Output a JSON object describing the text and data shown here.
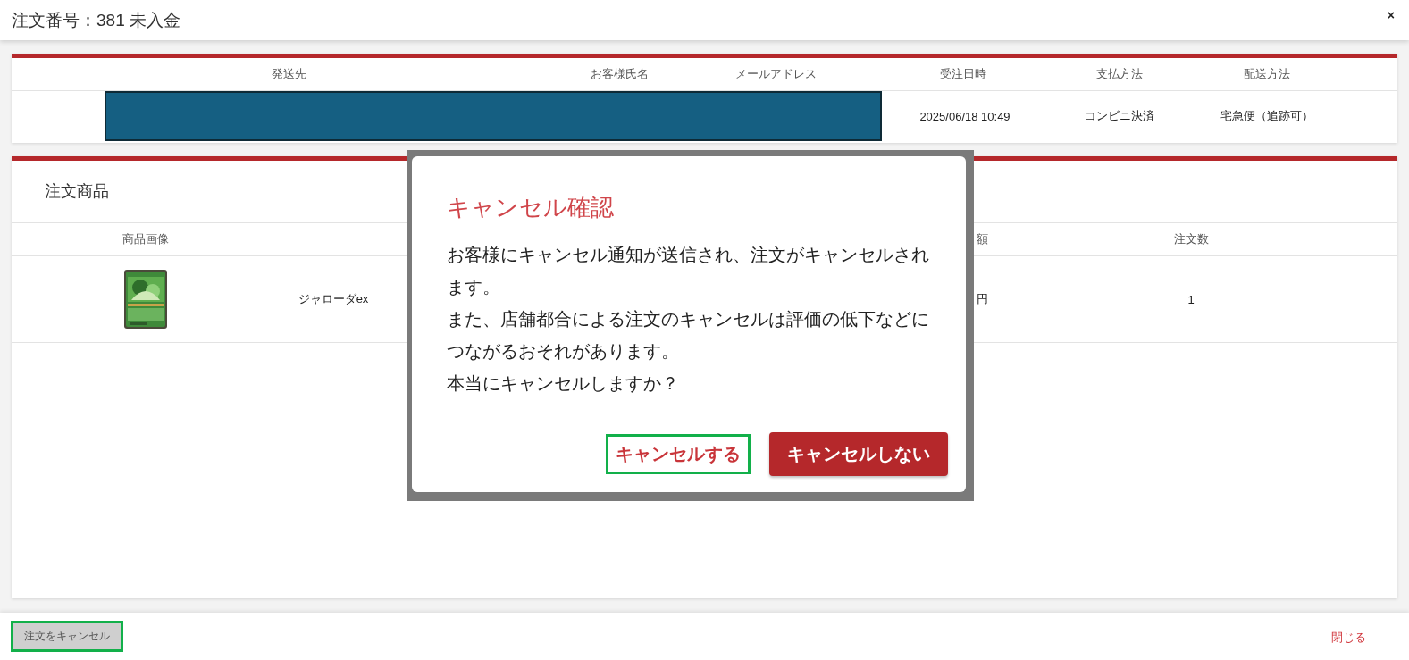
{
  "dialog_header": {
    "title": "注文番号：381 未入金",
    "close": "×"
  },
  "order_info": {
    "columns": [
      "発送先",
      "お客様氏名",
      "メールアドレス",
      "受注日時",
      "支払方法",
      "配送方法"
    ],
    "row": {
      "redacted": true,
      "cells": [
        "2025/06/18 10:49",
        "コンビニ決済",
        "宅急便（追跡可）"
      ]
    }
  },
  "items": {
    "title": "注文商品",
    "image_column": "商品画像",
    "column_3": "額",
    "quantity_column": "注文数",
    "rows": [
      {
        "name": "ジャローダex",
        "column_3": "円",
        "quantity": "1"
      }
    ]
  },
  "modal": {
    "title": "キャンセル確認",
    "paragraphs": [
      "お客様にキャンセル通知が送信され、注文がキャンセルされます。",
      "また、店舗都合による注文のキャンセルは評価の低下などにつながるおそれがあります。",
      "本当にキャンセルしますか？"
    ],
    "buttons": [
      {
        "label": "キャンセルする",
        "kind": "text",
        "highlighted": true
      },
      {
        "label": "キャンセルしない",
        "kind": "filled",
        "highlighted": false
      }
    ]
  },
  "footer": {
    "buttons": [
      {
        "label": "注文をキャンセル",
        "kind": "grey",
        "highlighted": true
      },
      {
        "label": "閉じる",
        "kind": "link",
        "highlighted": false
      }
    ]
  }
}
